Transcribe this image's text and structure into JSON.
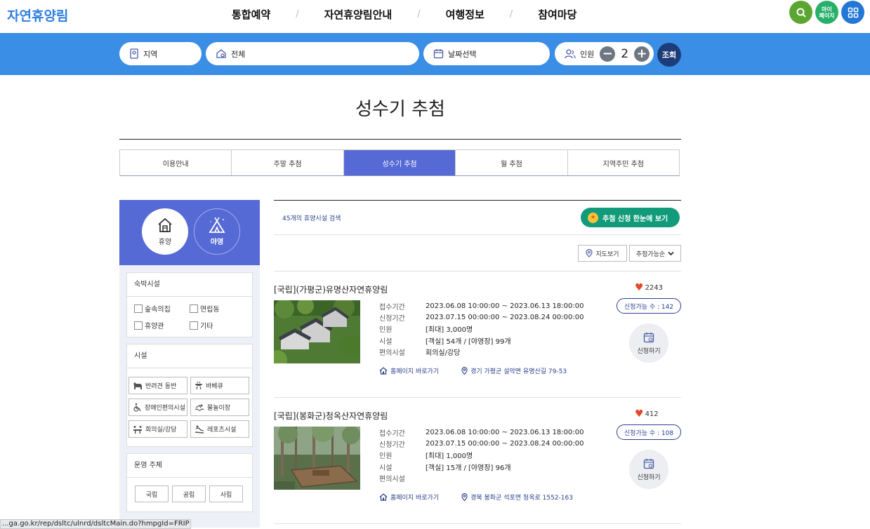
{
  "header": {
    "logo": "자연휴양림",
    "nav": [
      "통합예약",
      "자연휴양림안내",
      "여행정보",
      "참여마당"
    ],
    "mypage_label": "마이\n페이지"
  },
  "search": {
    "region": "지역",
    "type": "전체",
    "date": "날짜선택",
    "people_label": "인원",
    "people_count": "2",
    "go": "조회"
  },
  "page": {
    "title": "성수기 추첨",
    "tabs": [
      "이용안내",
      "주말 추첨",
      "성수기 추첨",
      "월 추첨",
      "지역주민 추첨"
    ],
    "active_tab": 2
  },
  "sidebar": {
    "mode1": "휴양",
    "mode2": "야영",
    "lodging_title": "숙박시설",
    "lodging": [
      "숲속의집",
      "연립동",
      "휴양관",
      "기타"
    ],
    "facility_title": "시설",
    "facilities": [
      "반려견 동반",
      "바베큐",
      "장애인편의시설",
      "물놀이장",
      "회의실/강당",
      "레포츠시설"
    ],
    "operator_title": "운영 주체",
    "operators": [
      "국립",
      "공립",
      "사립"
    ]
  },
  "results": {
    "count_text": "45개의 휴양시설 검색",
    "summary_btn": "추첨 신청 한눈에 보기",
    "map_btn": "지도보기",
    "sort": "추첨가능순"
  },
  "labels": {
    "reception": "접수기간",
    "application": "신청기간",
    "people": "인원",
    "facility": "시설",
    "amenity": "편의시설",
    "homepage": "홈페이지 바로가기",
    "apply": "신청하기"
  },
  "cards": [
    {
      "name": "[국립](가평군)유명산자연휴양림",
      "likes": "2243",
      "reception": "2023.06.08 10:00:00 ~ 2023.06.13 18:00:00",
      "application": "2023.07.15 00:00:00 ~ 2023.08.24 00:00:00",
      "people": "[최대] 3,000명",
      "facility": "[객실] 54개 / [야영장] 99개",
      "amenity": "회의실/강당",
      "address": "경기 가평군 설악면 유명산길 79-53",
      "available": "신청가능 수 : 142"
    },
    {
      "name": "[국립](봉화군)청옥산자연휴양림",
      "likes": "412",
      "reception": "2023.06.08 10:00:00 ~ 2023.06.13 18:00:00",
      "application": "2023.07.15 00:00:00 ~ 2023.08.24 00:00:00",
      "people": "[최대] 1,000명",
      "facility": "[객실] 15개 / [야영장] 96개",
      "amenity": "",
      "address": "경북 봉화군 석포면 청옥로 1552-163",
      "available": "신청가능 수 : 108"
    }
  ],
  "status_url": "...ga.go.kr/rep/dsltc/ulnrd/dsltcMain.do?hmpgId=FRIP"
}
